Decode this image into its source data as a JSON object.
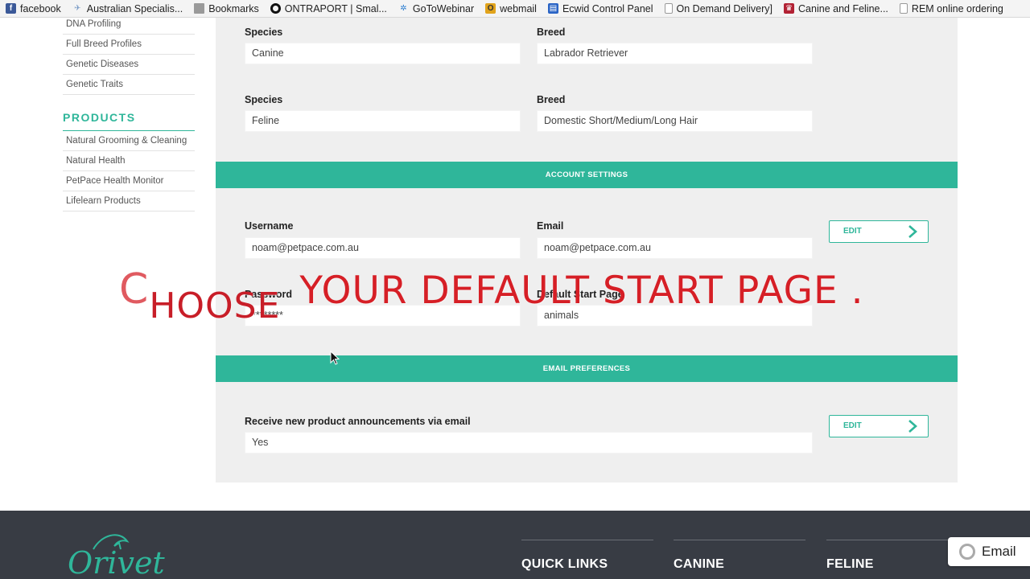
{
  "bookmarks_bar": {
    "items": [
      {
        "label": "facebook",
        "icon": "facebook-icon",
        "color": "#3b5998"
      },
      {
        "label": "Australian Specialis...",
        "icon": "plane-icon",
        "color": "#7a9cc6"
      },
      {
        "label": "Bookmarks",
        "icon": "folder-icon",
        "color": "#8a8a8a"
      },
      {
        "label": "ONTRAPORT | Smal...",
        "icon": "ontraport-icon",
        "color": "#111111"
      },
      {
        "label": "GoToWebinar",
        "icon": "gotowebinar-icon",
        "color": "#2f7fd0"
      },
      {
        "label": "webmail",
        "icon": "webmail-icon",
        "color": "#e1a31b"
      },
      {
        "label": "Ecwid Control Panel",
        "icon": "ecwid-icon",
        "color": "#2a64c5"
      },
      {
        "label": "On Demand Delivery]",
        "icon": "page-icon",
        "color": "#9a9a9a"
      },
      {
        "label": "Canine and Feline...",
        "icon": "crest-icon",
        "color": "#b22234"
      },
      {
        "label": "REM online ordering",
        "icon": "page-icon",
        "color": "#9a9a9a"
      }
    ]
  },
  "sidebar": {
    "items_top": [
      "DNA Profiling",
      "Full Breed Profiles",
      "Genetic Diseases",
      "Genetic Traits"
    ],
    "products_heading": "PRODUCTS",
    "products_items": [
      "Natural Grooming & Cleaning",
      "Natural Health",
      "PetPace Health Monitor",
      "Lifelearn Products"
    ]
  },
  "animals": [
    {
      "species_label": "Species",
      "species": "Canine",
      "breed_label": "Breed",
      "breed": "Labrador Retriever"
    },
    {
      "species_label": "Species",
      "species": "Feline",
      "breed_label": "Breed",
      "breed": "Domestic Short/Medium/Long Hair"
    }
  ],
  "account_settings": {
    "heading": "ACCOUNT SETTINGS",
    "username_label": "Username",
    "username": "noam@petpace.com.au",
    "email_label": "Email",
    "email": "noam@petpace.com.au",
    "password_label": "Password",
    "password": "********",
    "start_page_label": "Default Start Page",
    "start_page": "animals",
    "edit_label": "EDIT"
  },
  "email_preferences": {
    "heading": "EMAIL PREFERENCES",
    "announcements_label": "Receive new product announcements via email",
    "announcements_value": "Yes",
    "edit_label": "EDIT"
  },
  "overlay_caption": {
    "first_letter": "C",
    "rest_of_first_word": "HOOSE",
    "remainder": "YOUR DEFAULT START PAGE .",
    "color": "#d61f26"
  },
  "footer": {
    "logo_text": "Orivet",
    "columns": [
      "QUICK LINKS",
      "CANINE",
      "FELINE"
    ],
    "email_widget_label": "Email"
  },
  "colors": {
    "accent": "#2fb69a",
    "panel": "#efefef",
    "footer": "#383c44"
  }
}
